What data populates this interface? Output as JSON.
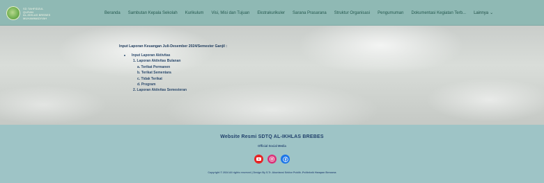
{
  "header": {
    "brand_lines": [
      "SD TAHFIDZUL QURAN",
      "AL-IKHLAS BREBES",
      "MUHAMMADIYAH"
    ],
    "nav": [
      "Beranda",
      "Sambutan Kepala Sekolah",
      "Kurikulum",
      "Visi, Misi dan Tujuan",
      "Ekstrakurikuler",
      "Sarana Prasarana",
      "Struktur Organisasi",
      "Pengumuman",
      "Dokumentasi Kegiatan Terb...",
      "Lainnya"
    ]
  },
  "content": {
    "heading": "Input Laporan Keuangan Juli-Desember 2024/Semester Ganjil :",
    "bullet": "Input Laporan Aktivitas",
    "item1": "1.  Laporan Aktivitas Bulanan",
    "sub": [
      "a.  Terikat Permanen",
      "b.  Terikat Sementara",
      "c.  Tidak Terikat",
      "d.  Program"
    ],
    "item2": "2.  Laporan Aktivitas Semesteran"
  },
  "footer": {
    "title": "Website Resmi SDTQ AL-IKHLAS BREBES",
    "subtitle": "Official Social Media",
    "socials": [
      "youtube-icon",
      "instagram-icon",
      "facebook-icon"
    ],
    "copyright": "Copyright © 2024  All rights reserved | Design By S.Tr. Akuntansi Sektor Publik -Politeknik Harapan Bersama"
  },
  "colors": {
    "header_bg": "#8fb9b4",
    "footer_bg": "#9ec4c6",
    "youtube": "#e62424",
    "instagram": "#d9357a",
    "facebook": "#1c76e8"
  }
}
